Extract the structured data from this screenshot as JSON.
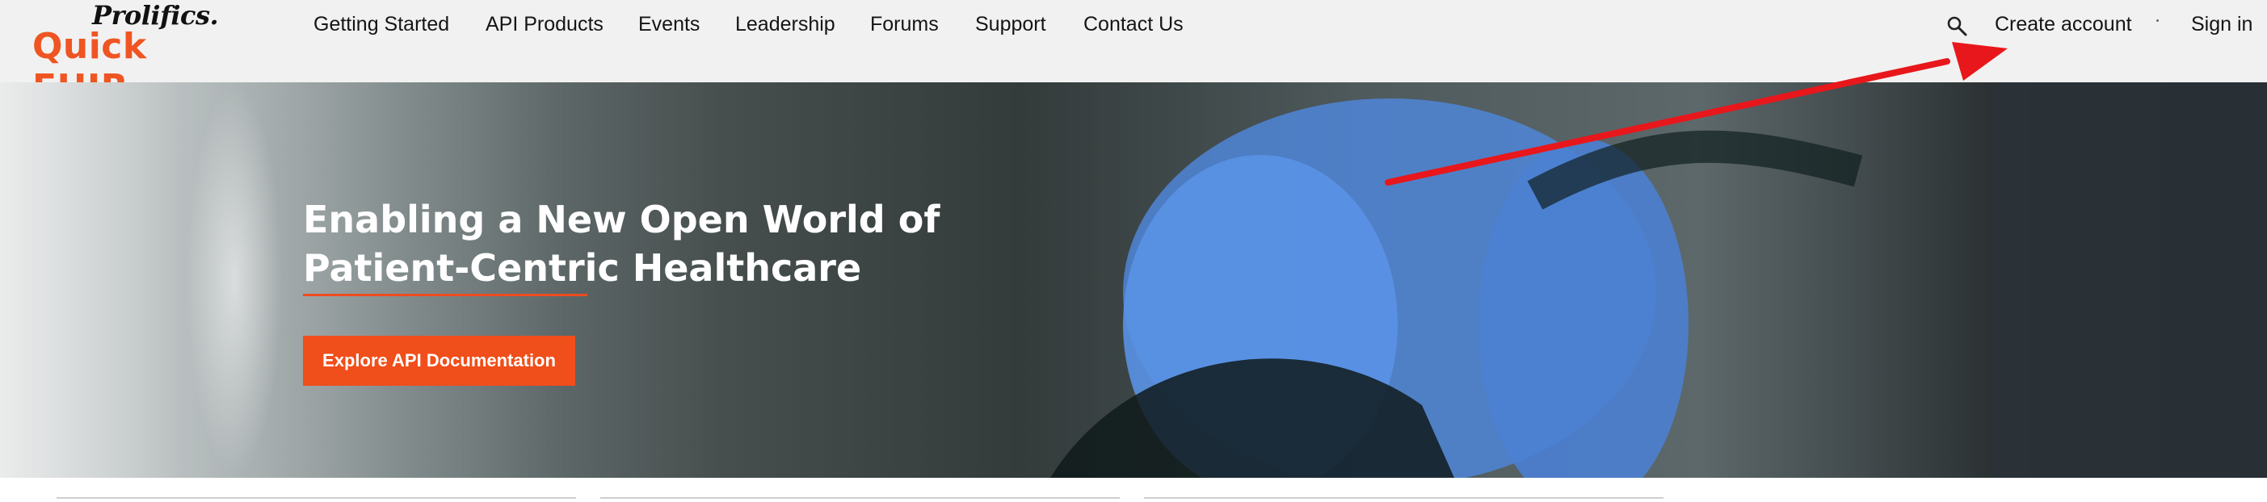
{
  "logo": {
    "brand": "Prolifics.",
    "product": "Quick FHIR"
  },
  "nav": {
    "items": [
      "Getting Started",
      "API Products",
      "Events",
      "Leadership",
      "Forums",
      "Support",
      "Contact Us"
    ]
  },
  "account": {
    "create": "Create account",
    "signin": "Sign in"
  },
  "hero": {
    "headline_line1": "Enabling a New Open World of",
    "headline_line2a": "Patient-Centric",
    "headline_line2b": " Healthcare",
    "cta": "Explore API Documentation"
  },
  "colors": {
    "accent": "#f04e1a",
    "annotation_arrow": "#e8171b",
    "topbar": "#f1f1f1"
  },
  "icons": [
    "search-icon",
    "annotation-arrow"
  ]
}
